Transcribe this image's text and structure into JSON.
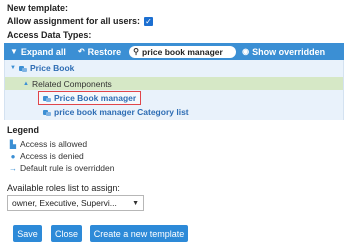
{
  "header": {
    "title": "New template:",
    "allow_label": "Allow assignment for all users:",
    "allow_checked": true,
    "access_data_types_label": "Access Data Types:"
  },
  "toolbar": {
    "expand_all": "Expand all",
    "restore": "Restore",
    "search_value": "price book manager",
    "show_overridden": "Show overridden",
    "color": "#3b8fd4"
  },
  "tree": {
    "root": "Price Book",
    "related": "Related Components",
    "selected_item": "Price Book manager",
    "item2": "price book manager Category list"
  },
  "legend": {
    "title": "Legend",
    "allowed": "Access is allowed",
    "denied": "Access is denied",
    "overridden": "Default rule is overridden"
  },
  "roles": {
    "label": "Available roles list to assign:",
    "selected": "owner, Executive, Supervi..."
  },
  "buttons": {
    "save": "Save",
    "close": "Close",
    "create": "Create a new template",
    "color": "#2d8ad8"
  }
}
